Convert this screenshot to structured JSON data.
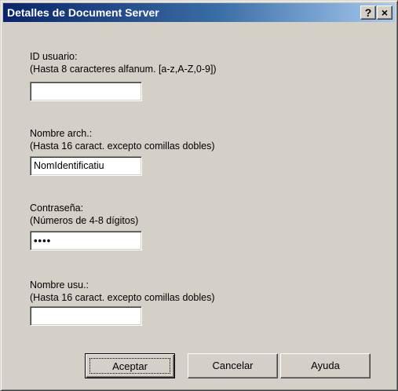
{
  "window": {
    "title": "Detalles de Document Server",
    "help_label": "?",
    "close_label": "×"
  },
  "fields": {
    "user_id": {
      "label": "ID usuario:",
      "hint": "(Hasta 8 caracteres alfanum. [a-z,A-Z,0-9])",
      "value": ""
    },
    "file_name": {
      "label": "Nombre arch.:",
      "hint": "(Hasta 16 caract. excepto comillas dobles)",
      "value": "NomIdentificatiu"
    },
    "password": {
      "label": "Contraseña:",
      "hint": "(Números de 4-8 dígitos)",
      "value": "••••"
    },
    "user_name": {
      "label": "Nombre usu.:",
      "hint": "(Hasta 16 caract. excepto comillas dobles)",
      "value": ""
    }
  },
  "buttons": {
    "accept": "Aceptar",
    "cancel": "Cancelar",
    "help": "Ayuda"
  },
  "colors": {
    "titlebar_start": "#0a246a",
    "titlebar_end": "#a6caf0",
    "dialog_bg": "#d4d0c8"
  }
}
